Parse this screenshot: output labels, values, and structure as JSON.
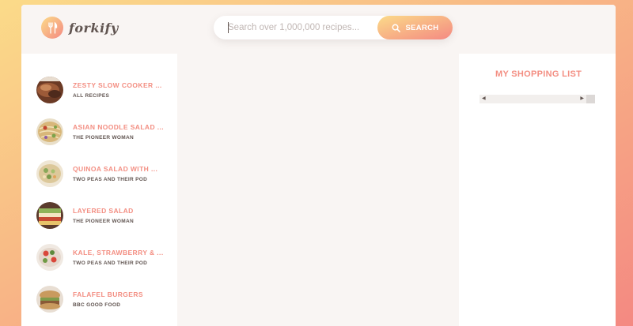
{
  "header": {
    "logo_text": "forkify",
    "search": {
      "placeholder": "Search over 1,000,000 recipes...",
      "value": "",
      "button_label": "SEARCH"
    }
  },
  "results": [
    {
      "title": "ZESTY SLOW COOKER ...",
      "publisher": "ALL RECIPES",
      "image": "grilled meat dish"
    },
    {
      "title": "ASIAN NOODLE SALAD ...",
      "publisher": "THE PIONEER WOMAN",
      "image": "noodle salad"
    },
    {
      "title": "QUINOA SALAD WITH ...",
      "publisher": "TWO PEAS AND THEIR POD",
      "image": "quinoa salad"
    },
    {
      "title": "LAYERED SALAD",
      "publisher": "THE PIONEER WOMAN",
      "image": "layered salad"
    },
    {
      "title": "KALE, STRAWBERRY & ...",
      "publisher": "TWO PEAS AND THEIR POD",
      "image": "kale strawberry salad"
    },
    {
      "title": "FALAFEL BURGERS",
      "publisher": "BBC GOOD FOOD",
      "image": "falafel burger"
    }
  ],
  "shopping_list": {
    "title": "MY SHOPPING LIST",
    "items": []
  },
  "colors": {
    "accent": "#f38e82",
    "text": "#615551",
    "gradient_start": "#fbdb89",
    "gradient_end": "#f48982",
    "panel_bg": "#f9f5f3"
  }
}
